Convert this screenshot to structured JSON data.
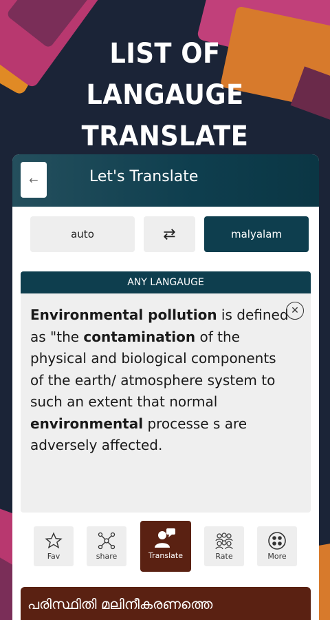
{
  "headline": {
    "line1": "LIST OF",
    "line2": "LANGAUGE TRANSLATE"
  },
  "appbar": {
    "title": "Let's Translate",
    "back_icon": "arrow-left-icon"
  },
  "languages": {
    "source": "auto",
    "target": "malyalam",
    "swap_icon": "swap-arrows-icon"
  },
  "section_label": "ANY LANGAUGE",
  "source_text": {
    "segments": [
      {
        "text": "Environmental pollution",
        "bold": true
      },
      {
        "text": " is defined as \"the ",
        "bold": false
      },
      {
        "text": "contamination",
        "bold": true
      },
      {
        "text": " of the physical and biological components of the earth/ atmosphere system to such an extent that normal ",
        "bold": false
      },
      {
        "text": "environmental",
        "bold": true
      },
      {
        "text": " processe s are adversely affected.",
        "bold": false
      }
    ],
    "clear_icon": "close-circle-icon"
  },
  "actions": {
    "fav": "Fav",
    "share": "share",
    "translate": "Translate",
    "rate": "Rate",
    "more": "More"
  },
  "result_text": "പരിസ്ഥിതി മലിനീകരണത്തെ",
  "colors": {
    "background": "#1b2437",
    "primary": "#0e3e4e",
    "accent": "#5a2112"
  }
}
